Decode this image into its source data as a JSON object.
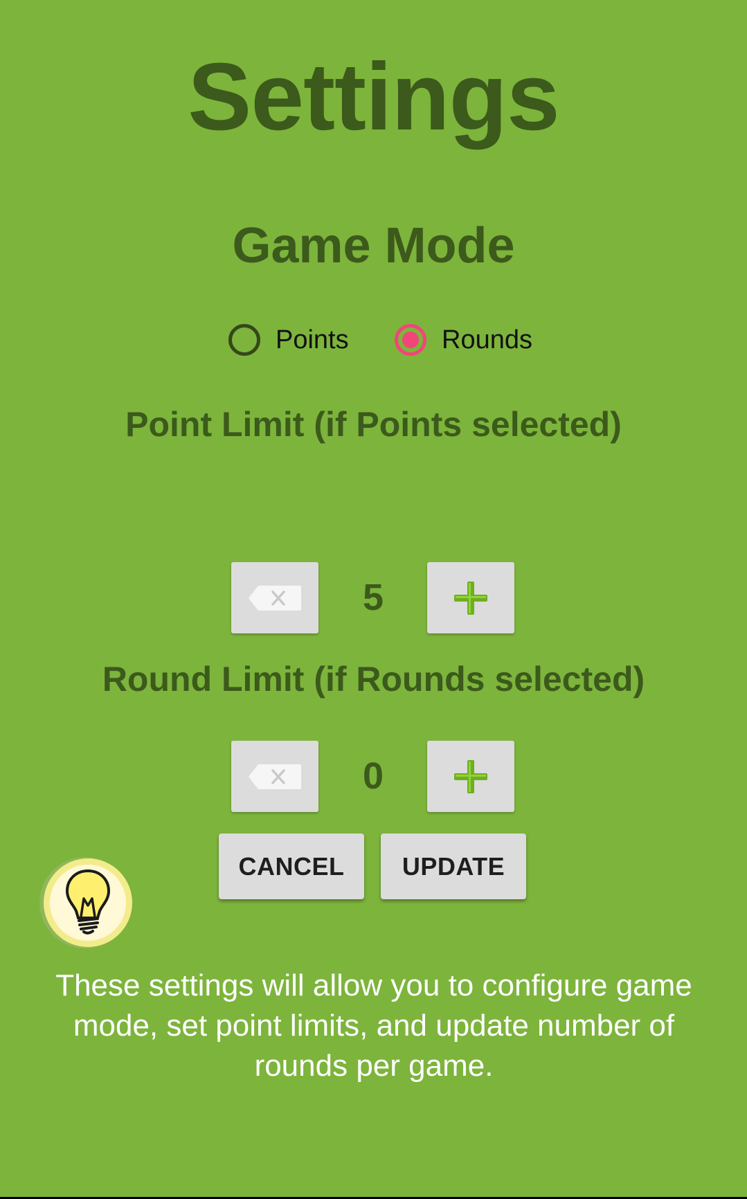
{
  "page": {
    "title": "Settings"
  },
  "game_mode": {
    "title": "Game Mode",
    "options": [
      {
        "label": "Points",
        "selected": false
      },
      {
        "label": "Rounds",
        "selected": true
      }
    ]
  },
  "point_limit": {
    "title": "Point Limit (if Points selected)",
    "value": "5",
    "decrement_icon": "backspace-icon",
    "increment_icon": "plus-icon"
  },
  "round_limit": {
    "title": "Round Limit (if Rounds selected)",
    "value": "0",
    "decrement_icon": "backspace-icon",
    "increment_icon": "plus-icon"
  },
  "actions": {
    "cancel_label": "CANCEL",
    "update_label": "UPDATE"
  },
  "hint": {
    "icon": "lightbulb-icon",
    "text": "These settings will allow you to configure game mode, set point limits, and update number of rounds per game."
  },
  "colors": {
    "background": "#7db43c",
    "heading": "#3b5a1b",
    "radio_selected": "#f2457a",
    "button": "#dcdcdc",
    "plus": "#6fae1e",
    "hint_text": "#ffffff"
  }
}
